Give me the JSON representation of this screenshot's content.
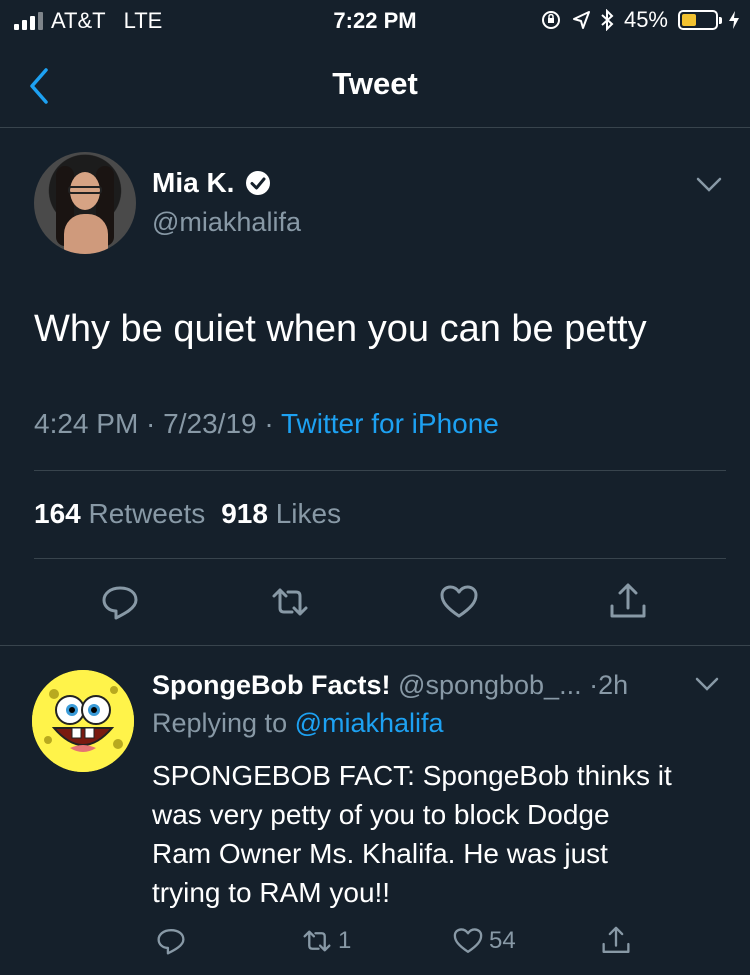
{
  "status_bar": {
    "carrier": "AT&T",
    "network": "LTE",
    "time": "7:22 PM",
    "battery": "45%",
    "battery_level": 0.45,
    "battery_color": "#f2c230"
  },
  "nav": {
    "back_icon": "chevron-left-icon",
    "title": "Tweet"
  },
  "tweet": {
    "name": "Mia K.",
    "handle": "@miakhalifa",
    "verified": true,
    "text": "Why be quiet when you can be petty",
    "time": "4:24 PM",
    "date": "7/23/19",
    "source": "Twitter for iPhone",
    "retweets_count": "164",
    "retweets_label": "Retweets",
    "likes_count": "918",
    "likes_label": "Likes",
    "actions": [
      "reply-icon",
      "retweet-icon",
      "like-icon",
      "share-icon"
    ]
  },
  "reply": {
    "name": "SpongeBob Facts!",
    "handle": "@spongbob_...",
    "time": "2h",
    "replying_prefix": "Replying to",
    "replying_to": "@miakhalifa",
    "lines": [
      "SPONGEBOB FACT: SpongeBob thinks it",
      "was very petty of you to block Dodge",
      "Ram Owner Ms. Khalifa. He was just",
      "trying to RAM you!!"
    ],
    "retweets": "1",
    "likes": "54"
  },
  "colors": {
    "background": "#15202b",
    "accent": "#1da1f2",
    "muted": "#8899a6",
    "divider": "#38444d"
  }
}
